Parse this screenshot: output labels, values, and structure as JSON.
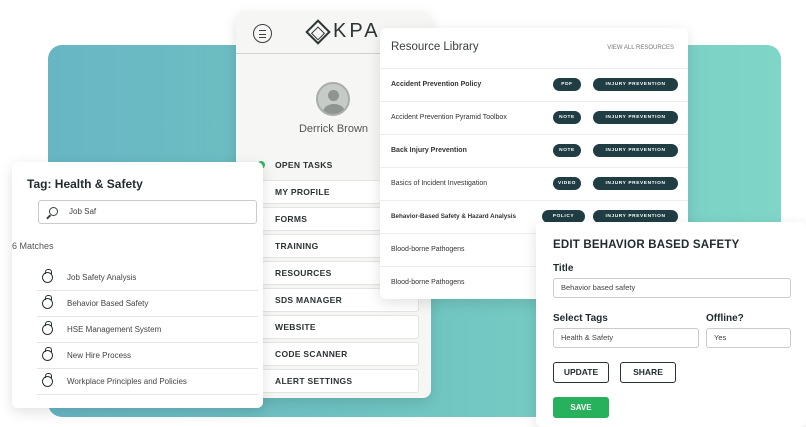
{
  "app": {
    "logo_text": "KPA",
    "user_name": "Derrick Brown",
    "nav": [
      {
        "label": "OPEN TASKS"
      },
      {
        "label": "MY PROFILE"
      },
      {
        "label": "FORMS"
      },
      {
        "label": "TRAINING"
      },
      {
        "label": "RESOURCES"
      },
      {
        "label": "SDS MANAGER"
      },
      {
        "label": "WEBSITE"
      },
      {
        "label": "CODE SCANNER"
      },
      {
        "label": "ALERT SETTINGS"
      }
    ]
  },
  "library": {
    "title": "Resource Library",
    "link": "VIEW ALL RESOURCES",
    "rows": [
      {
        "name": "Accident Prevention Policy",
        "tag1": "PDF",
        "tag2": "INJURY PREVENTION"
      },
      {
        "name": "Accident Prevention Pyramid Toolbox",
        "tag1": "NOTE",
        "tag2": "INJURY PREVENTION"
      },
      {
        "name": "Back Injury Prevention",
        "tag1": "NOTE",
        "tag2": "INJURY PREVENTION"
      },
      {
        "name": "Basics of Incident Investigation",
        "tag1": "VIDEO",
        "tag2": "INJURY PREVENTION"
      },
      {
        "name": "Behavior-Based Safety & Hazard Analysis",
        "tag1": "POLICY",
        "tag2": "INJURY PREVENTION"
      },
      {
        "name": "Blood-borne Pathogens",
        "tag1": "",
        "tag2": ""
      },
      {
        "name": "Blood-borne Pathogens",
        "tag1": "",
        "tag2": ""
      }
    ]
  },
  "tag_search": {
    "title": "Tag: Health & Safety",
    "query": "Job Saf",
    "matches_label": "6 Matches",
    "results": [
      {
        "label": "Job Safety Analysis"
      },
      {
        "label": "Behavior Based Safety"
      },
      {
        "label": "HSE Management System"
      },
      {
        "label": "New Hire Process"
      },
      {
        "label": "Workplace Principles and Policies"
      }
    ]
  },
  "edit": {
    "title": "EDIT BEHAVIOR BASED SAFETY",
    "title_label": "Title",
    "title_value": "Behavior based safety",
    "tags_label": "Select Tags",
    "tags_value": "Health & Safety",
    "offline_label": "Offline?",
    "offline_value": "Yes",
    "update_label": "UPDATE",
    "share_label": "SHARE",
    "save_label": "SAVE"
  },
  "colors": {
    "accent_green": "#27b15c",
    "pill_dark": "#1f3d43",
    "panel_teal": "#6fc3c1"
  }
}
